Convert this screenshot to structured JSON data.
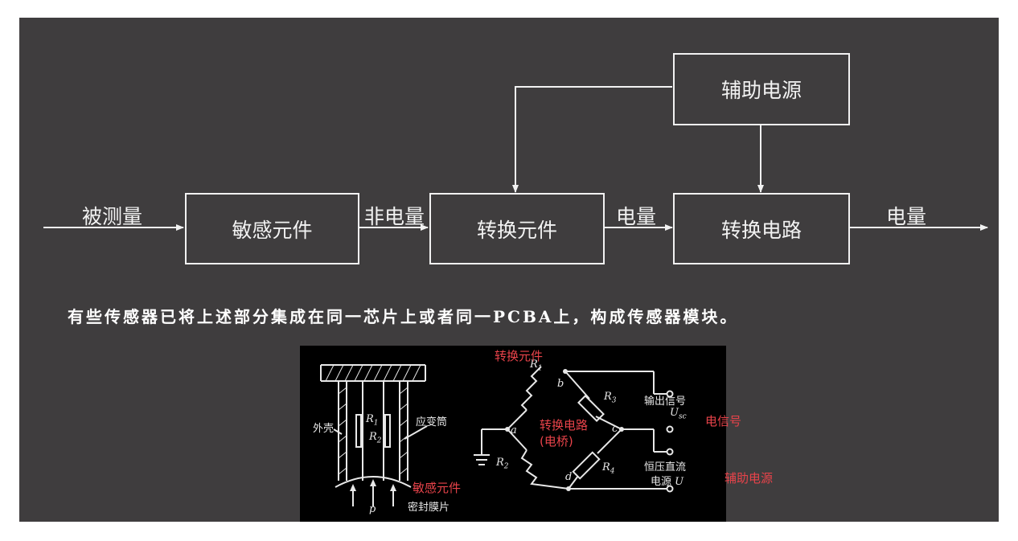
{
  "flow": {
    "nodes": {
      "sensitive": "敏感元件",
      "transducer": "转换元件",
      "circuit": "转换电路",
      "aux_power": "辅助电源"
    },
    "edges": {
      "input": "被测量",
      "non_electrical": "非电量",
      "electrical_1": "电量",
      "output": "电量"
    }
  },
  "caption": "有些传感器已将上述部分集成在同一芯片上或者同一PCBA上，构成传感器模块。",
  "figure": {
    "labels": {
      "shell": "外壳",
      "r1": "R",
      "r1_sub": "1",
      "r2": "R",
      "r2_sub": "2",
      "strain_tube": "应变筒",
      "p": "p",
      "seal_film": "密封膜片",
      "node_a": "a",
      "node_b": "b",
      "node_c": "c",
      "node_d": "d",
      "bridge_r1": "R",
      "bridge_r1_sub": "1",
      "bridge_r2": "R",
      "bridge_r2_sub": "2",
      "bridge_r3": "R",
      "bridge_r3_sub": "3",
      "bridge_r4": "R",
      "bridge_r4_sub": "4",
      "output_signal": "输出信号",
      "usc": "U",
      "usc_sub": "sc",
      "const_voltage": "恒压直流",
      "power_u_label": "电源",
      "power_u": "U"
    },
    "annotations": {
      "transducer": "转换元件",
      "circuit_line1": "转换电路",
      "circuit_line2": "(电桥)",
      "signal": "电信号",
      "aux_power": "辅助电源",
      "sensitive": "敏感元件"
    }
  },
  "colors": {
    "background": "#3f3d3e",
    "line": "#f2f2f2",
    "annotation": "#e8434a"
  }
}
